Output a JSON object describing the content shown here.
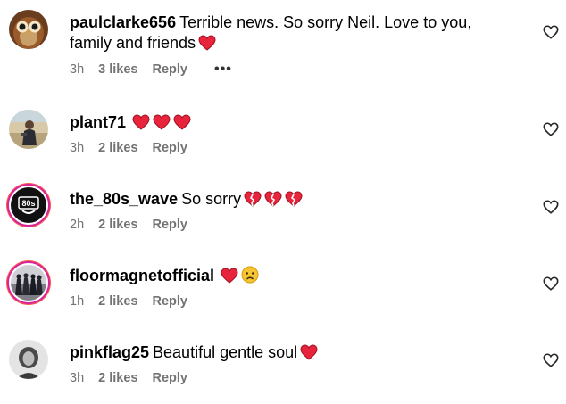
{
  "comments": [
    {
      "username": "paulclarke656",
      "text": "Terrible news. So sorry Neil. Love to you, family and friends",
      "emojis": [
        "red-heart"
      ],
      "time": "3h",
      "likes": "3 likes",
      "reply": "Reply",
      "more": "•••"
    },
    {
      "username": "plant71",
      "text": "",
      "emojis": [
        "red-heart",
        "red-heart",
        "red-heart"
      ],
      "time": "3h",
      "likes": "2 likes",
      "reply": "Reply"
    },
    {
      "username": "the_80s_wave",
      "text": "So sorry",
      "emojis": [
        "broken-heart",
        "broken-heart",
        "broken-heart"
      ],
      "time": "2h",
      "likes": "2 likes",
      "reply": "Reply",
      "avatar_text": "80s"
    },
    {
      "username": "floormagnetofficial",
      "text": "",
      "emojis": [
        "red-heart",
        "crying-face"
      ],
      "time": "1h",
      "likes": "2 likes",
      "reply": "Reply"
    },
    {
      "username": "pinkflag25",
      "text": "Beautiful gentle soul",
      "emojis": [
        "red-heart"
      ],
      "time": "3h",
      "likes": "2 likes",
      "reply": "Reply"
    }
  ],
  "colors": {
    "heart": "#e8243c",
    "meta": "#737373",
    "ring": "#d6249f"
  },
  "icons": {
    "like": "heart-outline-icon"
  }
}
